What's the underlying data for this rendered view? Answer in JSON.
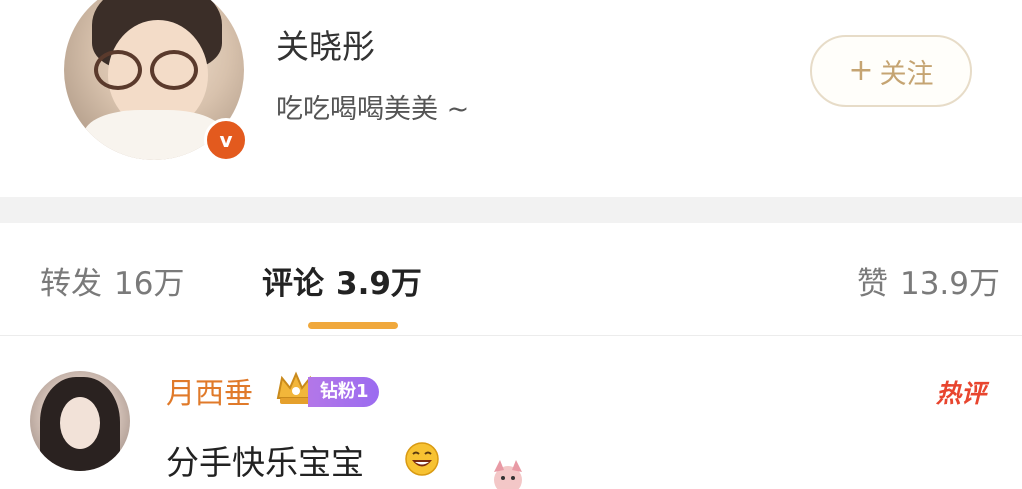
{
  "profile": {
    "name": "关晓彤",
    "bio": "吃吃喝喝美美 ~",
    "verified_mark": "v",
    "follow_label": "关注",
    "follow_plus": "+"
  },
  "stats": {
    "repost": {
      "label": "转发",
      "count": "16万"
    },
    "comment": {
      "label": "评论",
      "count": "3.9万",
      "active": true
    },
    "like": {
      "label": "赞",
      "count": "13.9万"
    }
  },
  "comment": {
    "author": "月西垂",
    "fan_badge": "钻粉1",
    "hot_label": "热评",
    "text": "分手快乐宝宝",
    "emoji": "laughing-face-icon",
    "sticker": "cartoon-sticker-icon"
  },
  "colors": {
    "accent": "#f0a83c",
    "follow_text": "#c5a472",
    "author_name": "#e07a2a",
    "hot": "#e8452e",
    "fan_badge": "#a873ea",
    "verified": "#e35a1e"
  }
}
